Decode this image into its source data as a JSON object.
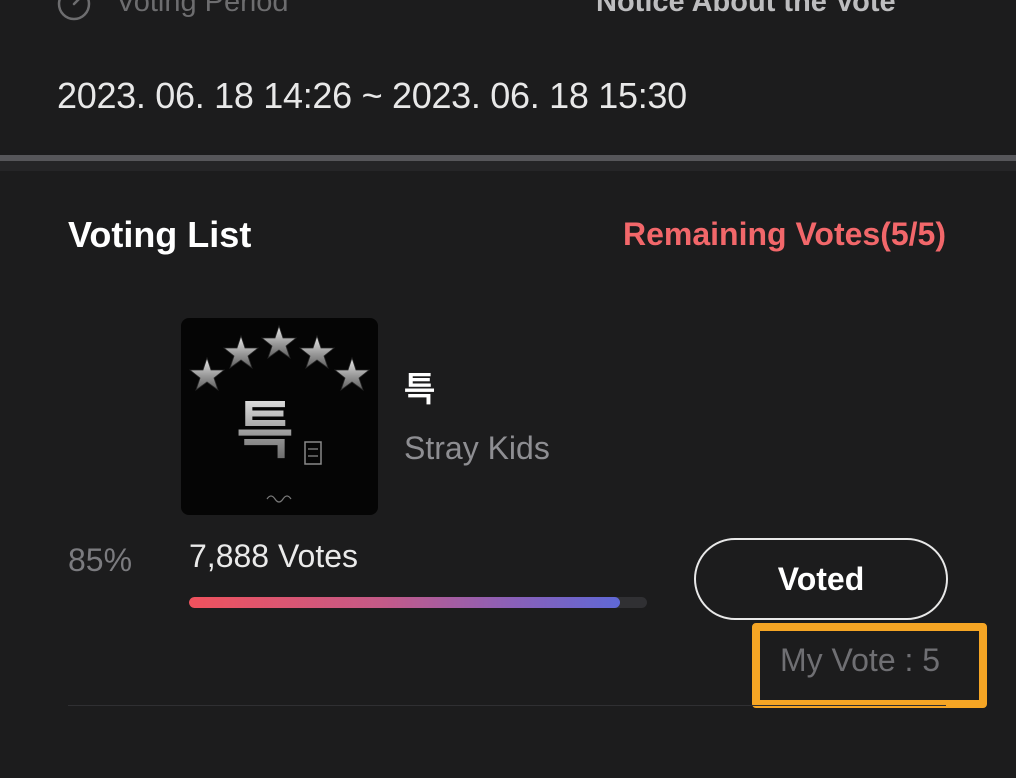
{
  "voting_period": {
    "label": "Voting Period",
    "range": "2023. 06. 18 14:26 ~ 2023. 06. 18 15:30",
    "icon": "clock-icon"
  },
  "notice": {
    "label": "Notice About the Vote"
  },
  "voting_list": {
    "title": "Voting List",
    "remaining_votes": "Remaining Votes(5/5)",
    "remaining_color": "#f2676a"
  },
  "candidates": [
    {
      "title": "특",
      "artist": "Stray Kids",
      "album_art_glyph": "특",
      "percent": "85%",
      "progress_fraction": 0.94,
      "votes": "7,888 Votes",
      "button_label": "Voted",
      "my_vote": "My Vote : 5"
    }
  ],
  "colors": {
    "background": "#1c1c1d",
    "highlight_box": "#f5a524",
    "progress_start": "#f0525d",
    "progress_end": "#5f68d6"
  }
}
